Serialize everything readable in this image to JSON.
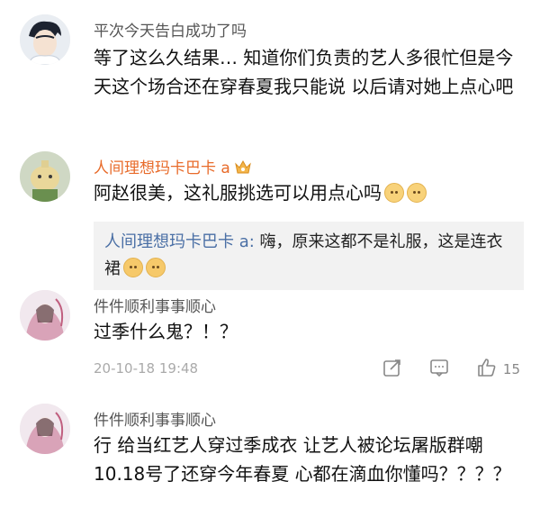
{
  "comments": [
    {
      "username": "平次今天告白成功了吗",
      "text": "等了这么久结果… 知道你们负责的艺人多很忙但是今天这个场合还在穿春夏我只能说 以后请对她上点心吧"
    },
    {
      "username": "人间理想玛卡巴卡 a",
      "text": "阿赵很美，这礼服挑选可以用点心吗",
      "reply": {
        "name": "人间理想玛卡巴卡 a:",
        "text": " 嗨，原来这都不是礼服，这是连衣裙"
      }
    },
    {
      "username": "件件顺利事事顺心",
      "text": "过季什么鬼？！？",
      "timestamp": "20-10-18 19:48",
      "likes": "15"
    },
    {
      "username": "件件顺利事事顺心",
      "text": "行 给当红艺人穿过季成衣 让艺人被论坛屠版群嘲10.18号了还穿今年春夏 心都在滴血你懂吗？？？？"
    }
  ],
  "icons": {
    "share": "share-icon",
    "comment": "comment-icon",
    "like": "thumbs-up-icon"
  }
}
